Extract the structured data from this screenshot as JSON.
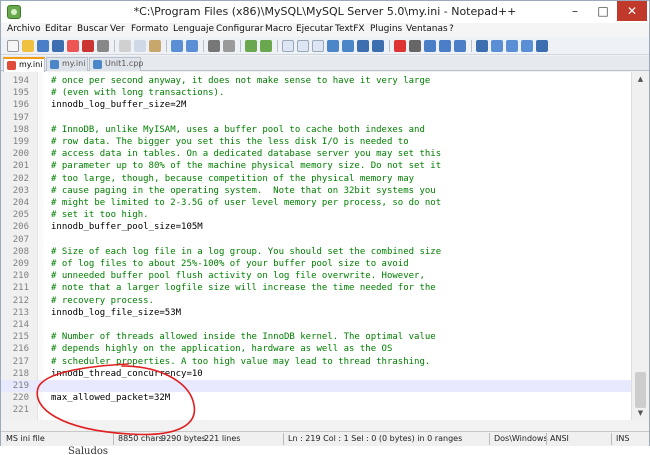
{
  "window": {
    "title": "*C:\\Program Files (x86)\\MySQL\\MySQL Server 5.0\\my.ini - Notepad++",
    "minimize": "–",
    "maximize": "□",
    "close": "✕"
  },
  "menu": [
    "Archivo",
    "Editar",
    "Buscar",
    "Ver",
    "Formato",
    "Lenguaje",
    "Configurar",
    "Macro",
    "Ejecutar",
    "TextFX",
    "Plugins",
    "Ventanas",
    "?"
  ],
  "tabs": [
    {
      "label": "my.ini",
      "active": true,
      "icon_color": "#e04b3a"
    },
    {
      "label": "my.ini",
      "active": false,
      "icon_color": "#4a86c8"
    },
    {
      "label": "Unit1.cpp",
      "active": false,
      "icon_color": "#4a86c8"
    }
  ],
  "lines": [
    {
      "num": "194",
      "text": "# once per second anyway, it does not make sense to have it very large",
      "type": "comment"
    },
    {
      "num": "195",
      "text": "# (even with long transactions).",
      "type": "comment"
    },
    {
      "num": "196",
      "text": "innodb_log_buffer_size=2M",
      "type": "plain"
    },
    {
      "num": "197",
      "text": "",
      "type": "plain"
    },
    {
      "num": "198",
      "text": "# InnoDB, unlike MyISAM, uses a buffer pool to cache both indexes and",
      "type": "comment"
    },
    {
      "num": "199",
      "text": "# row data. The bigger you set this the less disk I/O is needed to",
      "type": "comment"
    },
    {
      "num": "200",
      "text": "# access data in tables. On a dedicated database server you may set this",
      "type": "comment"
    },
    {
      "num": "201",
      "text": "# parameter up to 80% of the machine physical memory size. Do not set it",
      "type": "comment"
    },
    {
      "num": "202",
      "text": "# too large, though, because competition of the physical memory may",
      "type": "comment"
    },
    {
      "num": "203",
      "text": "# cause paging in the operating system.  Note that on 32bit systems you",
      "type": "comment"
    },
    {
      "num": "204",
      "text": "# might be limited to 2-3.5G of user level memory per process, so do not",
      "type": "comment"
    },
    {
      "num": "205",
      "text": "# set it too high.",
      "type": "comment"
    },
    {
      "num": "206",
      "text": "innodb_buffer_pool_size=105M",
      "type": "plain"
    },
    {
      "num": "207",
      "text": "",
      "type": "plain"
    },
    {
      "num": "208",
      "text": "# Size of each log file in a log group. You should set the combined size",
      "type": "comment"
    },
    {
      "num": "209",
      "text": "# of log files to about 25%-100% of your buffer pool size to avoid",
      "type": "comment"
    },
    {
      "num": "210",
      "text": "# unneeded buffer pool flush activity on log file overwrite. However,",
      "type": "comment"
    },
    {
      "num": "211",
      "text": "# note that a larger logfile size will increase the time needed for the",
      "type": "comment"
    },
    {
      "num": "212",
      "text": "# recovery process.",
      "type": "comment"
    },
    {
      "num": "213",
      "text": "innodb_log_file_size=53M",
      "type": "plain"
    },
    {
      "num": "214",
      "text": "",
      "type": "plain"
    },
    {
      "num": "215",
      "text": "# Number of threads allowed inside the InnoDB kernel. The optimal value",
      "type": "comment"
    },
    {
      "num": "216",
      "text": "# depends highly on the application, hardware as well as the OS",
      "type": "comment"
    },
    {
      "num": "217",
      "text": "# scheduler properties. A too high value may lead to thread thrashing.",
      "type": "comment"
    },
    {
      "num": "218",
      "text": "innodb_thread_concurrency=10",
      "type": "plain"
    },
    {
      "num": "219",
      "text": "",
      "type": "plain",
      "current": true
    },
    {
      "num": "220",
      "text": "max_allowed_packet=32M",
      "type": "plain"
    },
    {
      "num": "221",
      "text": "",
      "type": "plain"
    }
  ],
  "status": {
    "file_type": "MS ini file",
    "chars": "8850 chars",
    "bytes": "9290 bytes",
    "lines": "221 lines",
    "position": "Ln : 219   Col : 1   Sel : 0 (0 bytes) in 0 ranges",
    "eol": "Dos\\Windows",
    "encoding": "ANSI",
    "mode": "INS"
  },
  "below_text": "Saludos",
  "colors": {
    "comment": "#008000",
    "annotation_circle": "#e02020",
    "current_line": "#e8e8ff"
  }
}
